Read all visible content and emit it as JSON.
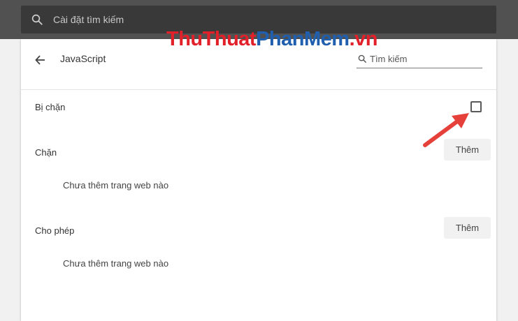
{
  "top_search": {
    "placeholder": "Cài đặt tìm kiếm",
    "icon": "search-icon"
  },
  "watermark": {
    "part_a": "ThuThuat",
    "part_b": "PhanMem",
    "part_c": ".vn"
  },
  "header": {
    "title": "JavaScript",
    "search_placeholder": "Tìm kiếm",
    "back_icon": "arrow-back-icon"
  },
  "blocked_row": {
    "label": "Bị chặn",
    "checked": false
  },
  "sections": {
    "block": {
      "title": "Chặn",
      "add_label": "Thêm",
      "empty_text": "Chưa thêm trang web nào"
    },
    "allow": {
      "title": "Cho phép",
      "add_label": "Thêm",
      "empty_text": "Chưa thêm trang web nào"
    }
  },
  "colors": {
    "topbar": "#515151",
    "top_search_bg": "#393939",
    "arrow": "#e5403a",
    "watermark_red": "#e2202a",
    "watermark_blue": "#1f5fad"
  }
}
